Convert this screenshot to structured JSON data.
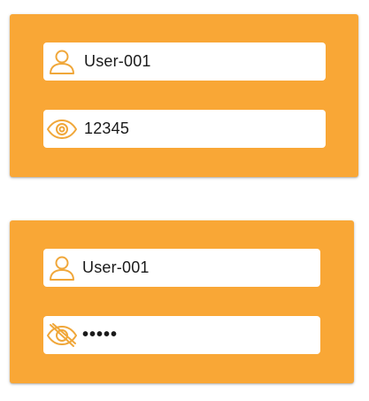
{
  "colors": {
    "card_background": "#f9a736",
    "field_background": "#ffffff",
    "icon_color": "#f0a73a",
    "text_color": "#1a1a1a"
  },
  "form_visible": {
    "username": {
      "icon": "user-icon",
      "value": "User-001"
    },
    "password": {
      "icon": "eye-icon",
      "value": "12345"
    }
  },
  "form_hidden": {
    "username": {
      "icon": "user-icon",
      "value": "User-001"
    },
    "password": {
      "icon": "eye-off-icon",
      "value": "•••••"
    }
  }
}
